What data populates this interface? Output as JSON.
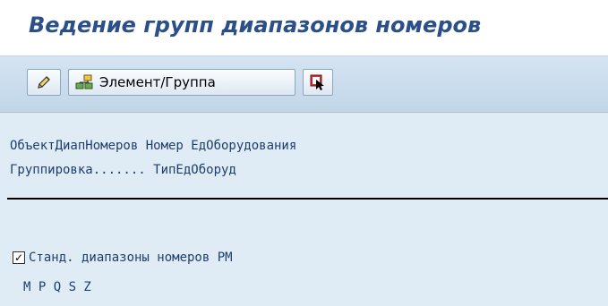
{
  "title": "Ведение групп диапазонов номеров",
  "toolbar": {
    "edit_icon": "pencil-icon",
    "element_group_icon": "hierarchy-icon",
    "element_group_label": "Элемент/Группа",
    "select_icon": "select-cursor-icon"
  },
  "header": {
    "line1": "ОбъектДиапНомеров Номер ЕдОборудования",
    "line2": "Группировка....... ТипЕдОборуд"
  },
  "group": {
    "checked": true,
    "label": "Станд. диапазоны номеров РМ",
    "codes": "M P Q S Z"
  },
  "colors": {
    "title": "#2b4f8a",
    "background": "#dfebf5",
    "text": "#1f3f6b"
  }
}
